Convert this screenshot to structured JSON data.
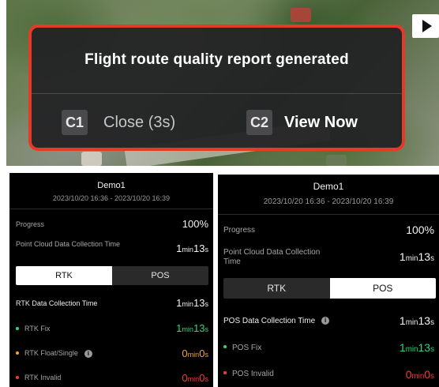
{
  "dialog": {
    "title": "Flight route quality report generated",
    "close_key": "C1",
    "close_label": "Close (3s)",
    "view_key": "C2",
    "view_label": "View Now",
    "border_color": "#e53a2a"
  },
  "panel_left": {
    "mission_name": "Demo1",
    "time_range": "2023/10/20 16:36 - 2023/10/20 16:39",
    "progress_label": "Progress",
    "progress_value": "100%",
    "progress_fraction": 1.0,
    "pcd_label": "Point Cloud Data Collection Time",
    "pcd_min": "1",
    "pcd_min_unit": "min",
    "pcd_sec": "13",
    "pcd_sec_unit": "s",
    "tabs": [
      "RTK",
      "POS"
    ],
    "active_tab": "RTK",
    "section_label": "RTK Data Collection Time",
    "section_min": "1",
    "section_min_unit": "min",
    "section_sec": "13",
    "section_sec_unit": "s",
    "rows": [
      {
        "label": "RTK Fix",
        "min": "1",
        "min_unit": "min",
        "sec": "13",
        "sec_unit": "s",
        "color": "#2fd67a"
      },
      {
        "label": "RTK Float/Single",
        "min": "0",
        "min_unit": "min",
        "sec": "0",
        "sec_unit": "s",
        "color": "#f6a623"
      },
      {
        "label": "RTK Invalid",
        "min": "0",
        "min_unit": "min",
        "sec": "0",
        "sec_unit": "s",
        "color": "#f23b37"
      }
    ]
  },
  "panel_right": {
    "mission_name": "Demo1",
    "time_range": "2023/10/20 16:36 - 2023/10/20 16:39",
    "progress_label": "Progress",
    "progress_value": "100%",
    "progress_fraction": 1.0,
    "pcd_label": "Point Cloud Data Collection Time",
    "pcd_min": "1",
    "pcd_min_unit": "min",
    "pcd_sec": "13",
    "pcd_sec_unit": "s",
    "tabs": [
      "RTK",
      "POS"
    ],
    "active_tab": "POS",
    "section_label": "POS Data Collection Time",
    "section_min": "1",
    "section_min_unit": "min",
    "section_sec": "13",
    "section_sec_unit": "s",
    "rows": [
      {
        "label": "POS Fix",
        "min": "1",
        "min_unit": "min",
        "sec": "13",
        "sec_unit": "s",
        "color": "#2fd67a"
      },
      {
        "label": "POS Invalid",
        "min": "0",
        "min_unit": "min",
        "sec": "0",
        "sec_unit": "s",
        "color": "#f23b37"
      }
    ]
  }
}
